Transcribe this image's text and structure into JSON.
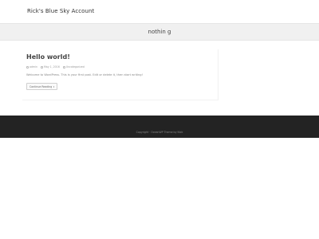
{
  "header": {
    "site_title": "Rick's Blue Sky Account"
  },
  "banner": {
    "title": "nothin g"
  },
  "post": {
    "title": "Hello world!",
    "meta": {
      "author": "admin",
      "date": "May 1, 2016",
      "category": "Uncategorized"
    },
    "excerpt": "Welcome to WordPress. This is your first post. Edit or delete it, then start writing!",
    "continue_label": "Continue Reading"
  },
  "footer": {
    "copyright": "Copyright · OceanWP Theme by Nick"
  }
}
